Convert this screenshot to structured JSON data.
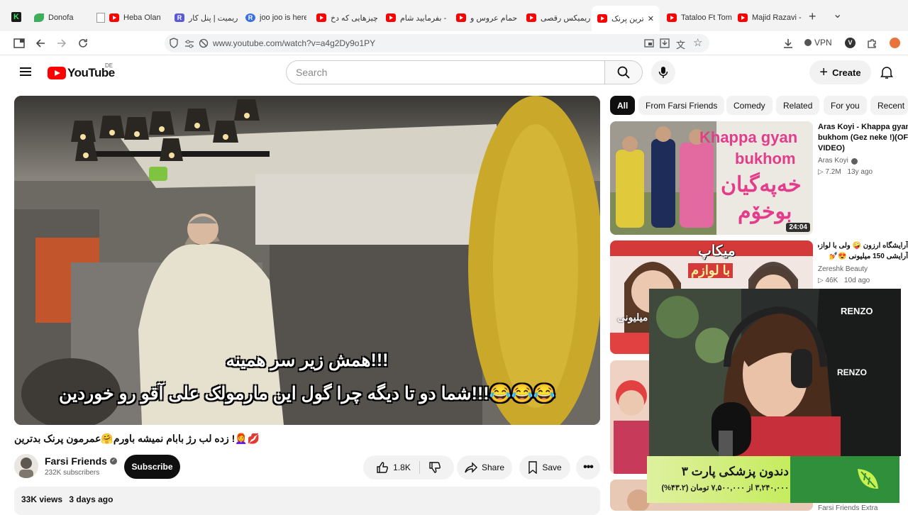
{
  "tabs": [
    {
      "label": "Donofa",
      "type": "generic"
    },
    {
      "label": "Heba Olan Dü",
      "type": "yt"
    },
    {
      "label": "ریمیت | پنل کار",
      "type": "generic"
    },
    {
      "label": "joo joo is here",
      "type": "generic"
    },
    {
      "label": "چیزهایی که دخ",
      "type": "yt"
    },
    {
      "label": "بفرمایید شام -",
      "type": "yt"
    },
    {
      "label": "حمام عروس و",
      "type": "yt"
    },
    {
      "label": "ریمیکس رقصی",
      "type": "yt"
    },
    {
      "label": "بدترین پرنک",
      "type": "yt"
    },
    {
      "label": "Tataloo Ft Tom",
      "type": "yt"
    },
    {
      "label": "Majid Razavi -",
      "type": "yt"
    }
  ],
  "tab_strip": {
    "new_tab_symbol": "+",
    "tab_list_symbol": "⌄",
    "close_symbol": "✕"
  },
  "address_bar": {
    "url": "www.youtube.com/watch?v=a4g2Dy9o1PY",
    "vpn_label": "VPN"
  },
  "header": {
    "logo_text": "YouTube",
    "country_code": "DE",
    "search_placeholder": "Search",
    "create_label": "Create"
  },
  "video": {
    "subtitle_line1": "همش زیر سر همینه!!!",
    "subtitle_line2": "شما دو تا دیگه چرا گول این مارمولک علی آقو رو خوردین!!!😂😂😂",
    "title": "💋👩‍🦰! زده لب رژ بابام نمیشه باورم🤗عمرمون پرنک بدترین",
    "channel_name": "Farsi Friends",
    "subscribers": "232K subscribers",
    "subscribe_label": "Subscribe",
    "likes": "1.8K",
    "share_label": "Share",
    "save_label": "Save",
    "views": "33K views",
    "age": "3 days ago"
  },
  "chips": [
    "All",
    "From Farsi Friends",
    "Comedy",
    "Related",
    "For you",
    "Recent"
  ],
  "recommendations": [
    {
      "title_line1": "Aras Koyi - Khappa gyan",
      "title_line2": "bukhom (Gez neke !)(OF",
      "title_line3": "VIDEO)",
      "channel": "Aras Koyi",
      "views": "7.2M",
      "age": "13y ago",
      "duration": "24:04",
      "thumb_text1": "Khappa gyan",
      "thumb_text2": "bukhom",
      "thumb_text3": "خەپەگیان",
      "thumb_text4": "بوخۆم"
    },
    {
      "title_line1": "آرایشگاه ارزون 🤪 ولی با لوازم",
      "title_line2": "آرایشی 150 میلیونی 😍💅",
      "channel": "Zereshk Beauty",
      "views": "46K",
      "age": "10d ago",
      "thumb_text1": "میکاپ",
      "thumb_text2": "با لوازم",
      "thumb_text3": "میلیونی"
    },
    {
      "channel": "Farsi Friends Extra"
    }
  ],
  "ad": {
    "title": "دندون پزشکی پارت ۳",
    "price_line": "۳,۲۴۰,۰۰۰ از ۷,۵۰۰,۰۰۰ تومان (۴۳.۲%)"
  },
  "colors": {
    "youtube_red": "#ff0000",
    "ad_green": "#c4ec5a",
    "ad_dark": "#2f8f3a"
  }
}
